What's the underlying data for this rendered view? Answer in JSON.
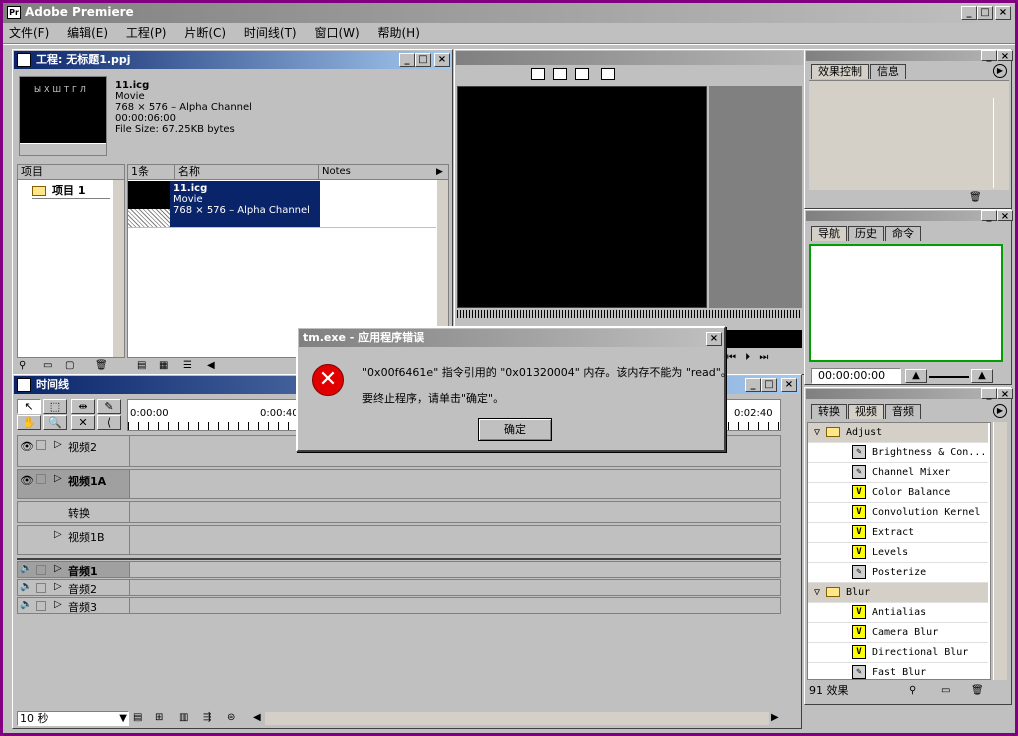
{
  "app": {
    "title": "Adobe Premiere"
  },
  "menu": [
    "文件(F)",
    "编辑(E)",
    "工程(P)",
    "片断(C)",
    "时间线(T)",
    "窗口(W)",
    "帮助(H)"
  ],
  "project": {
    "title": "工程: 无标题1.ppj",
    "preview": {
      "name": "11.icg",
      "type": "Movie",
      "dims": "768 × 576 – Alpha Channel",
      "duration": "00:00:06:00",
      "filesize": "File Size: 67.25KB bytes",
      "thumb_text": "ЫХШТГЛ"
    },
    "bins_header": "项目",
    "bin_item": "项目 1",
    "columns": {
      "count": "1条",
      "name": "名称",
      "notes": "Notes"
    },
    "clip": {
      "name": "11.icg",
      "type": "Movie",
      "dims": "768 × 576 – Alpha Channel"
    }
  },
  "timeline": {
    "title": "时间线",
    "ruler": [
      "0:00:00",
      "0:00:40",
      "0:02:40"
    ],
    "tracks": {
      "video2": "视频2",
      "video1a": "视频1A",
      "transition": "转换",
      "video1b": "视频1B",
      "audio1": "音频1",
      "audio2": "音频2",
      "audio3": "音频3"
    },
    "zoom": "10 秒"
  },
  "effect_controls": {
    "tabs": [
      "效果控制",
      "信息"
    ]
  },
  "navigator": {
    "tabs": [
      "导航",
      "历史",
      "命令"
    ],
    "timecode": "00:00:00:00"
  },
  "effects": {
    "tabs": [
      "转换",
      "视频",
      "音频"
    ],
    "groups": [
      {
        "name": "Adjust",
        "items": [
          "Brightness & Con...",
          "Channel Mixer",
          "Color Balance",
          "Convolution Kernel",
          "Extract",
          "Levels",
          "Posterize"
        ]
      },
      {
        "name": "Blur",
        "items": [
          "Antialias",
          "Camera Blur",
          "Directional Blur",
          "Fast Blur"
        ]
      }
    ],
    "count": "91 效果"
  },
  "dialog": {
    "title": "tm.exe - 应用程序错误",
    "message1": "\"0x00f6461e\" 指令引用的 \"0x01320004\" 内存。该内存不能为 \"read\"。",
    "message2": "要终止程序，请单击\"确定\"。",
    "ok": "确定"
  }
}
